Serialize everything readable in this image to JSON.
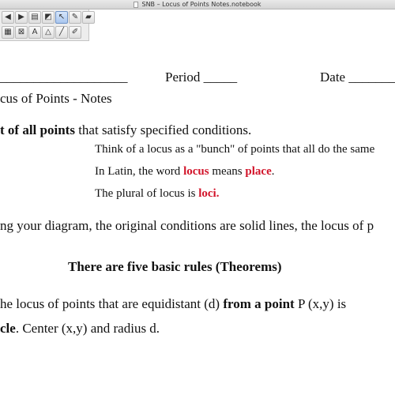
{
  "window": {
    "title": "SNB – Locus of Points Notes.notebook"
  },
  "toolbar": {
    "row1": [
      {
        "name": "page-back-icon",
        "glyph": "◀",
        "active": false
      },
      {
        "name": "page-forward-icon",
        "glyph": "▶",
        "active": false
      },
      {
        "name": "insert-page-icon",
        "glyph": "▤",
        "active": false
      },
      {
        "name": "screen-shade-icon",
        "glyph": "◩",
        "active": false
      },
      {
        "name": "select-pointer-icon",
        "glyph": "↖",
        "active": true
      },
      {
        "name": "pen-icon",
        "glyph": "✎",
        "active": false
      },
      {
        "name": "eraser-icon",
        "glyph": "▰",
        "active": false
      }
    ],
    "row2": [
      {
        "name": "table-icon",
        "glyph": "▦",
        "active": false
      },
      {
        "name": "fill-icon",
        "glyph": "⊠",
        "active": false
      },
      {
        "name": "text-icon",
        "glyph": "A",
        "active": false
      },
      {
        "name": "shapes-icon",
        "glyph": "△",
        "active": false
      },
      {
        "name": "line-icon",
        "glyph": "╱",
        "active": false
      },
      {
        "name": "creative-pen-icon",
        "glyph": "✐",
        "active": false
      }
    ]
  },
  "notes": {
    "name_blank": "___________________",
    "period_label": "Period _____",
    "date_label": "Date ________",
    "heading": "cus of Points - Notes",
    "definition_part1": "t",
    "definition_bold": " of all points",
    "definition_part2": " that satisfy specified conditions.",
    "think_line": "Think of a locus as a \"bunch\" of points that all do the same",
    "latin_part1": "In Latin, the word ",
    "latin_red1": "locus",
    "latin_part2": " means ",
    "latin_red2": "place",
    "latin_part3": ".",
    "plural_part1": "The plural of locus is ",
    "plural_red": "loci.",
    "diagram_line": "ng your diagram, the original conditions are solid lines, the locus of p",
    "rules_heading": "There are five basic rules (Theorems)",
    "rule1_part1": "he locus of points that are equidistant (d) ",
    "rule1_bold": "from a point",
    "rule1_part2": " P (x,y) is",
    "rule1b_bold": "cle",
    "rule1b_part": ".  Center (x,y) and radius d."
  }
}
